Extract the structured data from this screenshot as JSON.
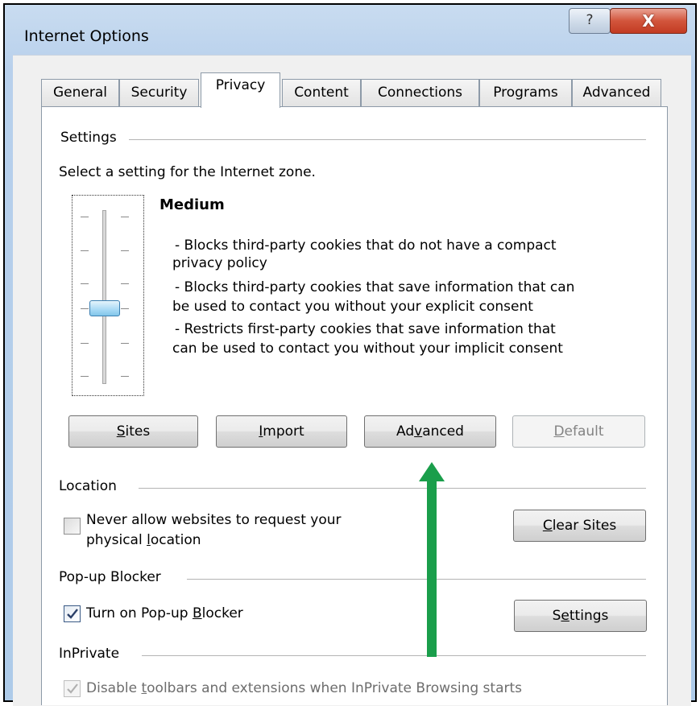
{
  "window": {
    "title": "Internet Options",
    "help_glyph": "?",
    "close_glyph": "X"
  },
  "tabs": [
    {
      "label": "General",
      "active": false
    },
    {
      "label": "Security",
      "active": false
    },
    {
      "label": "Privacy",
      "active": true
    },
    {
      "label": "Content",
      "active": false
    },
    {
      "label": "Connections",
      "active": false
    },
    {
      "label": "Programs",
      "active": false
    },
    {
      "label": "Advanced",
      "active": false
    }
  ],
  "settings": {
    "section_label": "Settings",
    "instruction": "Select a setting for the Internet zone.",
    "level_name": "Medium",
    "description_lines": [
      "- Blocks third-party cookies that do not have a compact",
      "privacy policy",
      "- Blocks third-party cookies that save information that can",
      "be used to contact you without your explicit consent",
      "- Restricts first-party cookies that save information that",
      "can be used to contact you without your implicit consent"
    ],
    "buttons": {
      "sites": {
        "pre": "",
        "key": "S",
        "post": "ites",
        "enabled": true
      },
      "import": {
        "pre": "",
        "key": "I",
        "post": "mport",
        "enabled": true
      },
      "advanced": {
        "pre": "Ad",
        "key": "v",
        "post": "anced",
        "enabled": true
      },
      "default": {
        "pre": "",
        "key": "D",
        "post": "efault",
        "enabled": false
      }
    }
  },
  "location": {
    "section_label": "Location",
    "checkbox_line1": "Never allow websites to request your",
    "checkbox_line2_pre": "physical ",
    "checkbox_line2_key": "l",
    "checkbox_line2_post": "ocation",
    "checked": false,
    "clear_sites": {
      "pre": "",
      "key": "C",
      "post": "lear Sites"
    }
  },
  "popup_blocker": {
    "section_label": "Pop-up Blocker",
    "checkbox_pre": "Turn on Pop-up ",
    "checkbox_key": "B",
    "checkbox_post": "locker",
    "checked": true,
    "settings_button": {
      "pre": "S",
      "key": "e",
      "post": "ttings"
    }
  },
  "inprivate": {
    "section_label": "InPrivate",
    "checkbox_pre": "Disable ",
    "checkbox_key": "t",
    "checkbox_post": "oolbars and extensions when InPrivate Browsing starts",
    "checked": true,
    "enabled": false
  },
  "colors": {
    "annotation_arrow": "#1a9e4b",
    "slider_thumb": "#a7d9f5",
    "close_button": "#c94a30"
  }
}
